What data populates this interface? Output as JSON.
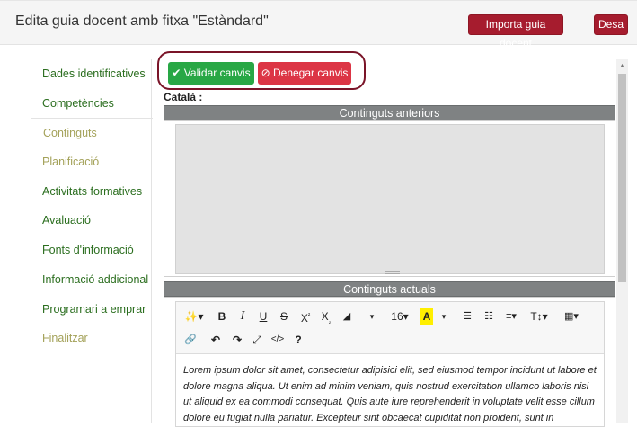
{
  "header": {
    "title": "Edita guia docent amb fitxa \"Estàndard\"",
    "import_label": "Importa guia docent",
    "save_label": "Desa"
  },
  "sidebar": {
    "items": [
      {
        "label": "Dades identificatives"
      },
      {
        "label": "Competències"
      },
      {
        "label": "Continguts"
      },
      {
        "label": "Planificació"
      },
      {
        "label": "Activitats formatives"
      },
      {
        "label": "Avaluació"
      },
      {
        "label": "Fonts d'informació"
      },
      {
        "label": "Informació addicional"
      },
      {
        "label": "Programari a emprar"
      },
      {
        "label": "Finalitzar"
      }
    ]
  },
  "actions": {
    "validate_label": "✔ Validar canvis",
    "deny_label": "⊘ Denegar canvis"
  },
  "content": {
    "language_label": "Català :",
    "previous_header": "Continguts anteriors",
    "current_header": "Continguts actuals"
  },
  "editor": {
    "font_size": "16",
    "text": "Lorem ipsum dolor sit amet, consectetur adipisici elit, sed eiusmod tempor incidunt ut labore et dolore magna aliqua. Ut enim ad minim veniam, quis nostrud exercitation ullamco laboris nisi ut aliquid ex ea commodi consequat. Quis aute iure reprehenderit in voluptate velit esse cillum dolore eu fugiat nulla pariatur. Excepteur sint obcaecat cupiditat non proident, sunt in"
  },
  "colors": {
    "brand": "#a61c2e",
    "success": "#28a745",
    "danger": "#dc3545",
    "nav": "#2b6e1f",
    "nav_muted": "#a4a25a",
    "section_header": "#7f8283"
  }
}
